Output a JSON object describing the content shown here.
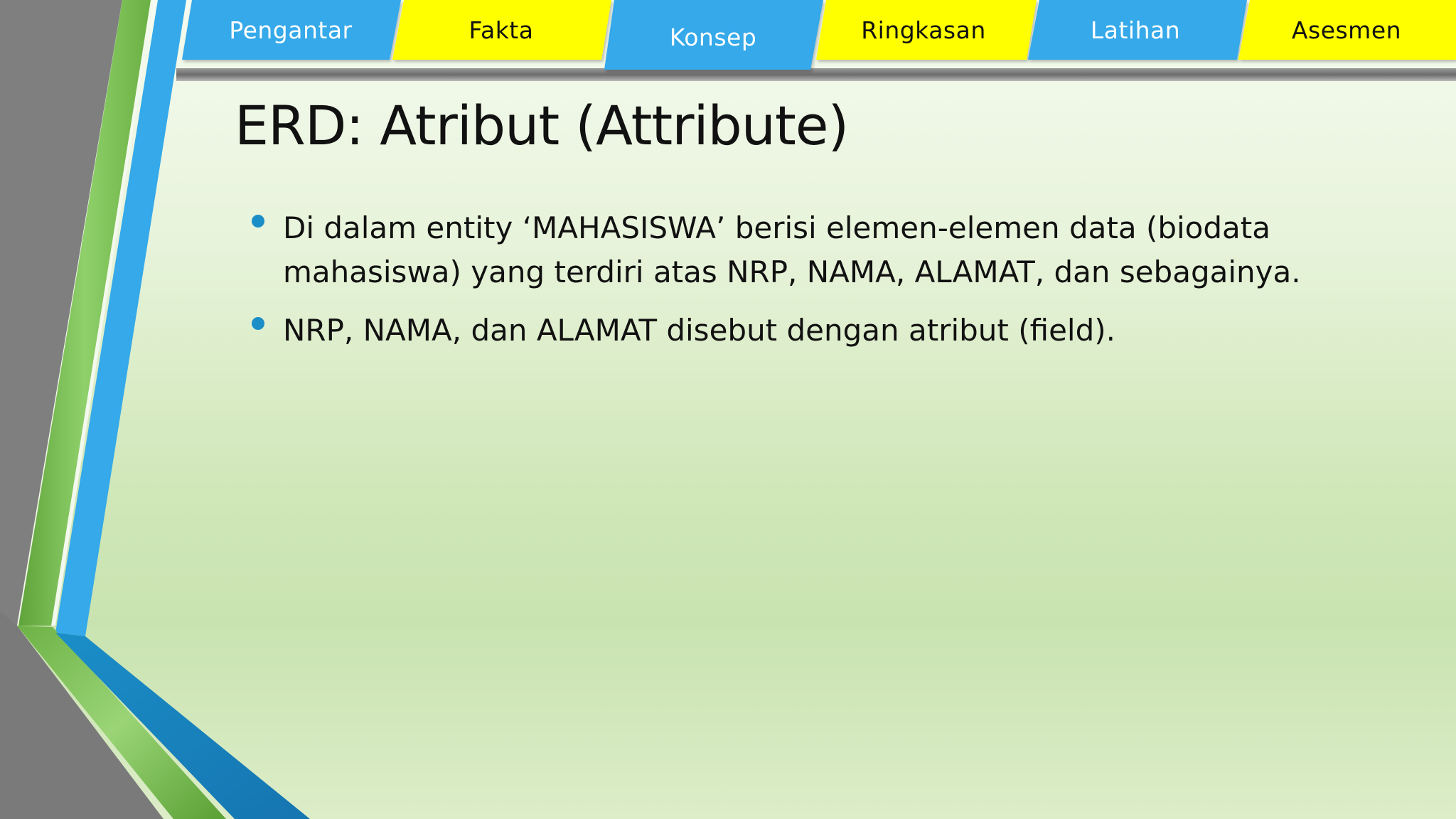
{
  "nav": {
    "tabs": [
      {
        "label": "Pengantar",
        "color": "#35a9e9",
        "text_color": "#ffffff"
      },
      {
        "label": "Fakta",
        "color": "#ffff00",
        "text_color": "#111111"
      },
      {
        "label": "Konsep",
        "color": "#35a9e9",
        "text_color": "#ffffff",
        "active": true
      },
      {
        "label": "Ringkasan",
        "color": "#ffff00",
        "text_color": "#111111"
      },
      {
        "label": "Latihan",
        "color": "#35a9e9",
        "text_color": "#ffffff"
      },
      {
        "label": "Asesmen",
        "color": "#ffff00",
        "text_color": "#111111"
      }
    ]
  },
  "slide": {
    "title": "ERD: Atribut (Attribute)",
    "bullets": [
      "Di dalam entity ‘MAHASISWA’ berisi elemen-elemen data (biodata mahasiswa) yang terdiri atas NRP, NAMA, ALAMAT, dan sebagainya.",
      "NRP, NAMA, dan ALAMAT disebut dengan atribut (field)."
    ]
  },
  "colors": {
    "accent_blue": "#35a9e9",
    "accent_yellow": "#ffff00",
    "accent_green": "#7cc04f",
    "side_gray": "#7f7f7f",
    "bullet": "#1b8ec8"
  }
}
